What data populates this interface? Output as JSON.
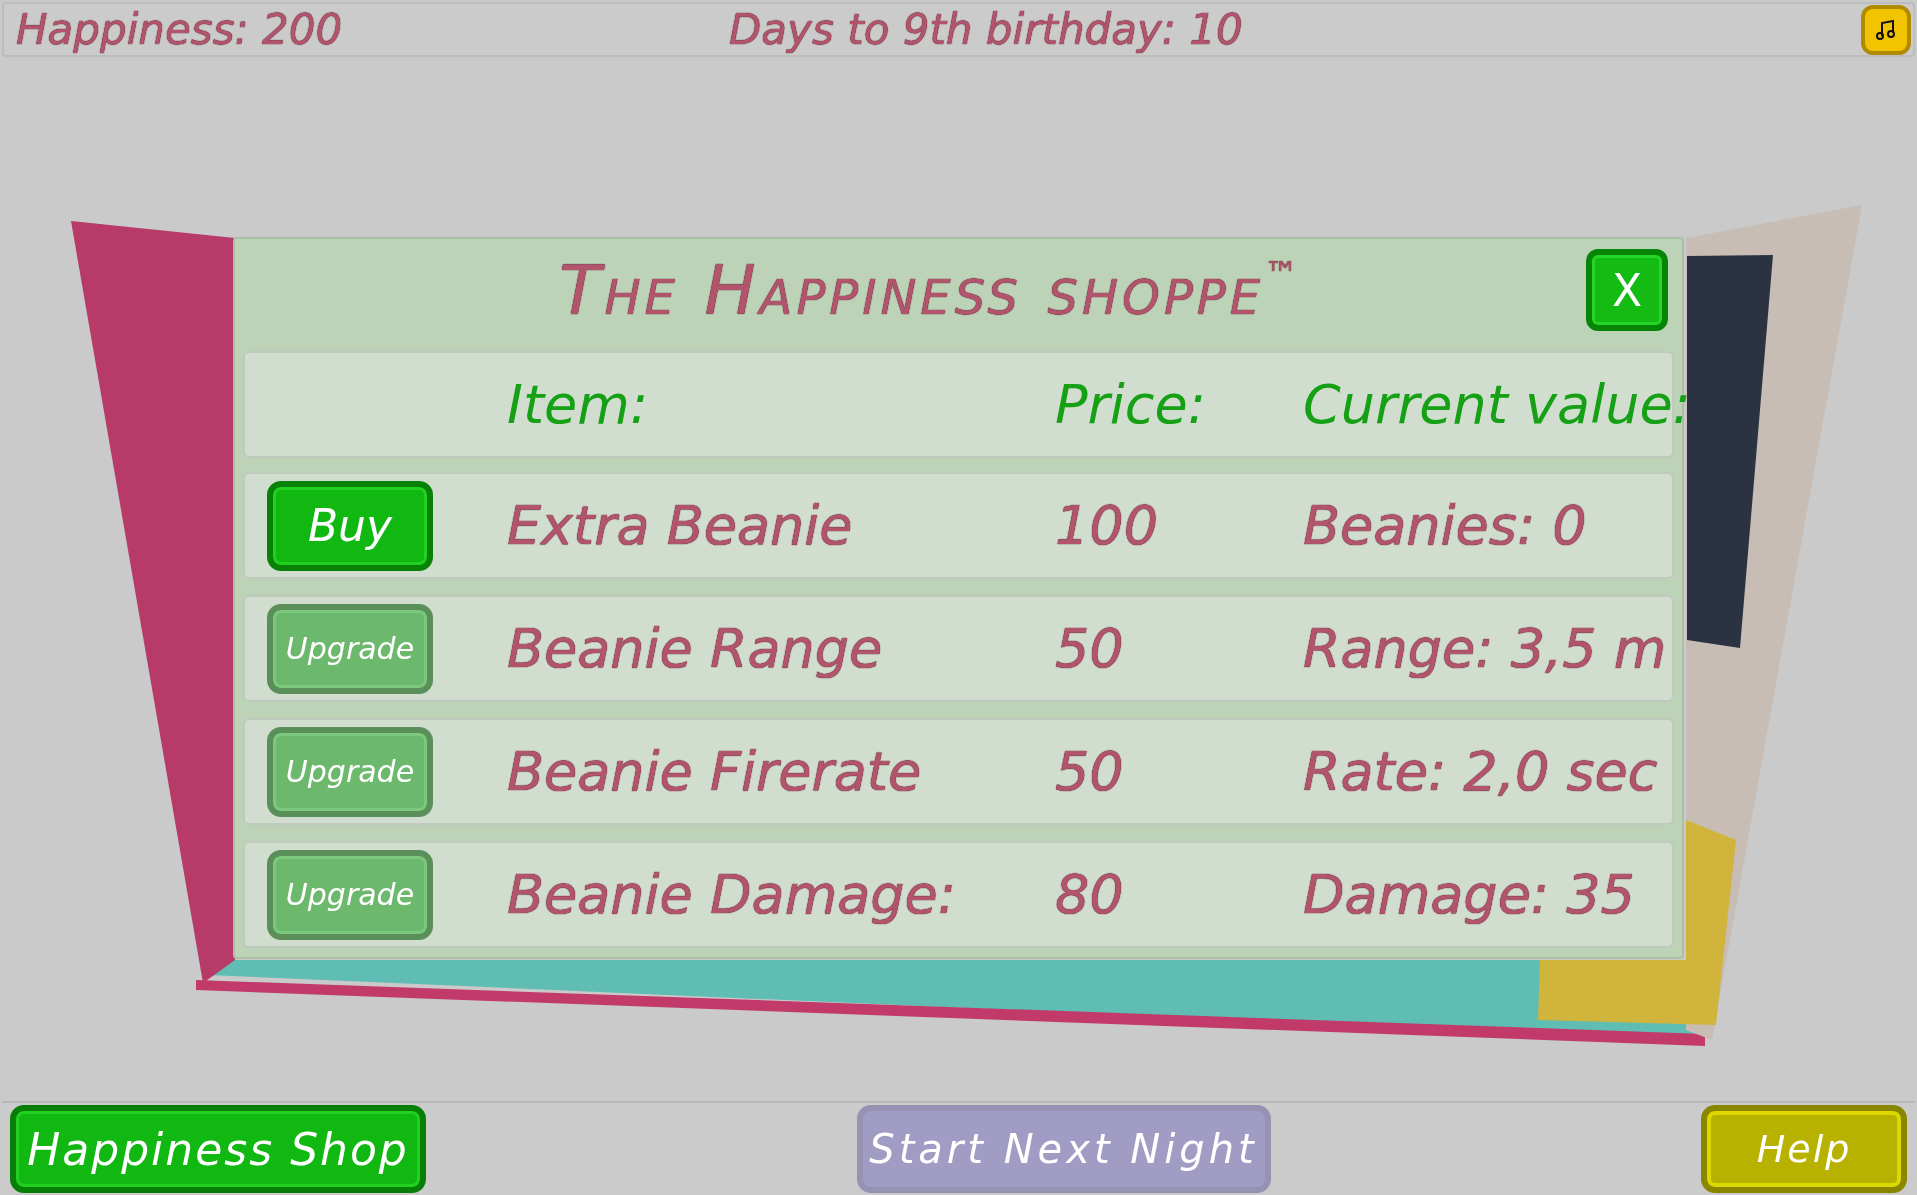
{
  "top_bar": {
    "happiness": "Happiness: 200",
    "countdown": "Days to 9th birthday: 10"
  },
  "shop": {
    "title": "The Happiness shoppe",
    "trademark": "™",
    "close_label": "X",
    "columns": [
      "Item:",
      "Price:",
      "Current value:"
    ],
    "rows": [
      {
        "action": "Buy",
        "disabled": false,
        "item": "Extra Beanie",
        "price": "100",
        "value": "Beanies: 0"
      },
      {
        "action": "Upgrade",
        "disabled": true,
        "item": "Beanie Range",
        "price": "50",
        "value": "Range: 3,5 m"
      },
      {
        "action": "Upgrade",
        "disabled": true,
        "item": "Beanie Firerate",
        "price": "50",
        "value": "Rate: 2,0 sec"
      },
      {
        "action": "Upgrade",
        "disabled": true,
        "item": "Beanie Damage:",
        "price": "80",
        "value": "Damage: 35"
      }
    ]
  },
  "bottom_bar": {
    "buttons": [
      {
        "label": "Happiness Shop",
        "kind": "shop"
      },
      {
        "label": "Start Next Night",
        "kind": "night"
      },
      {
        "label": "Help",
        "kind": "help"
      }
    ]
  }
}
